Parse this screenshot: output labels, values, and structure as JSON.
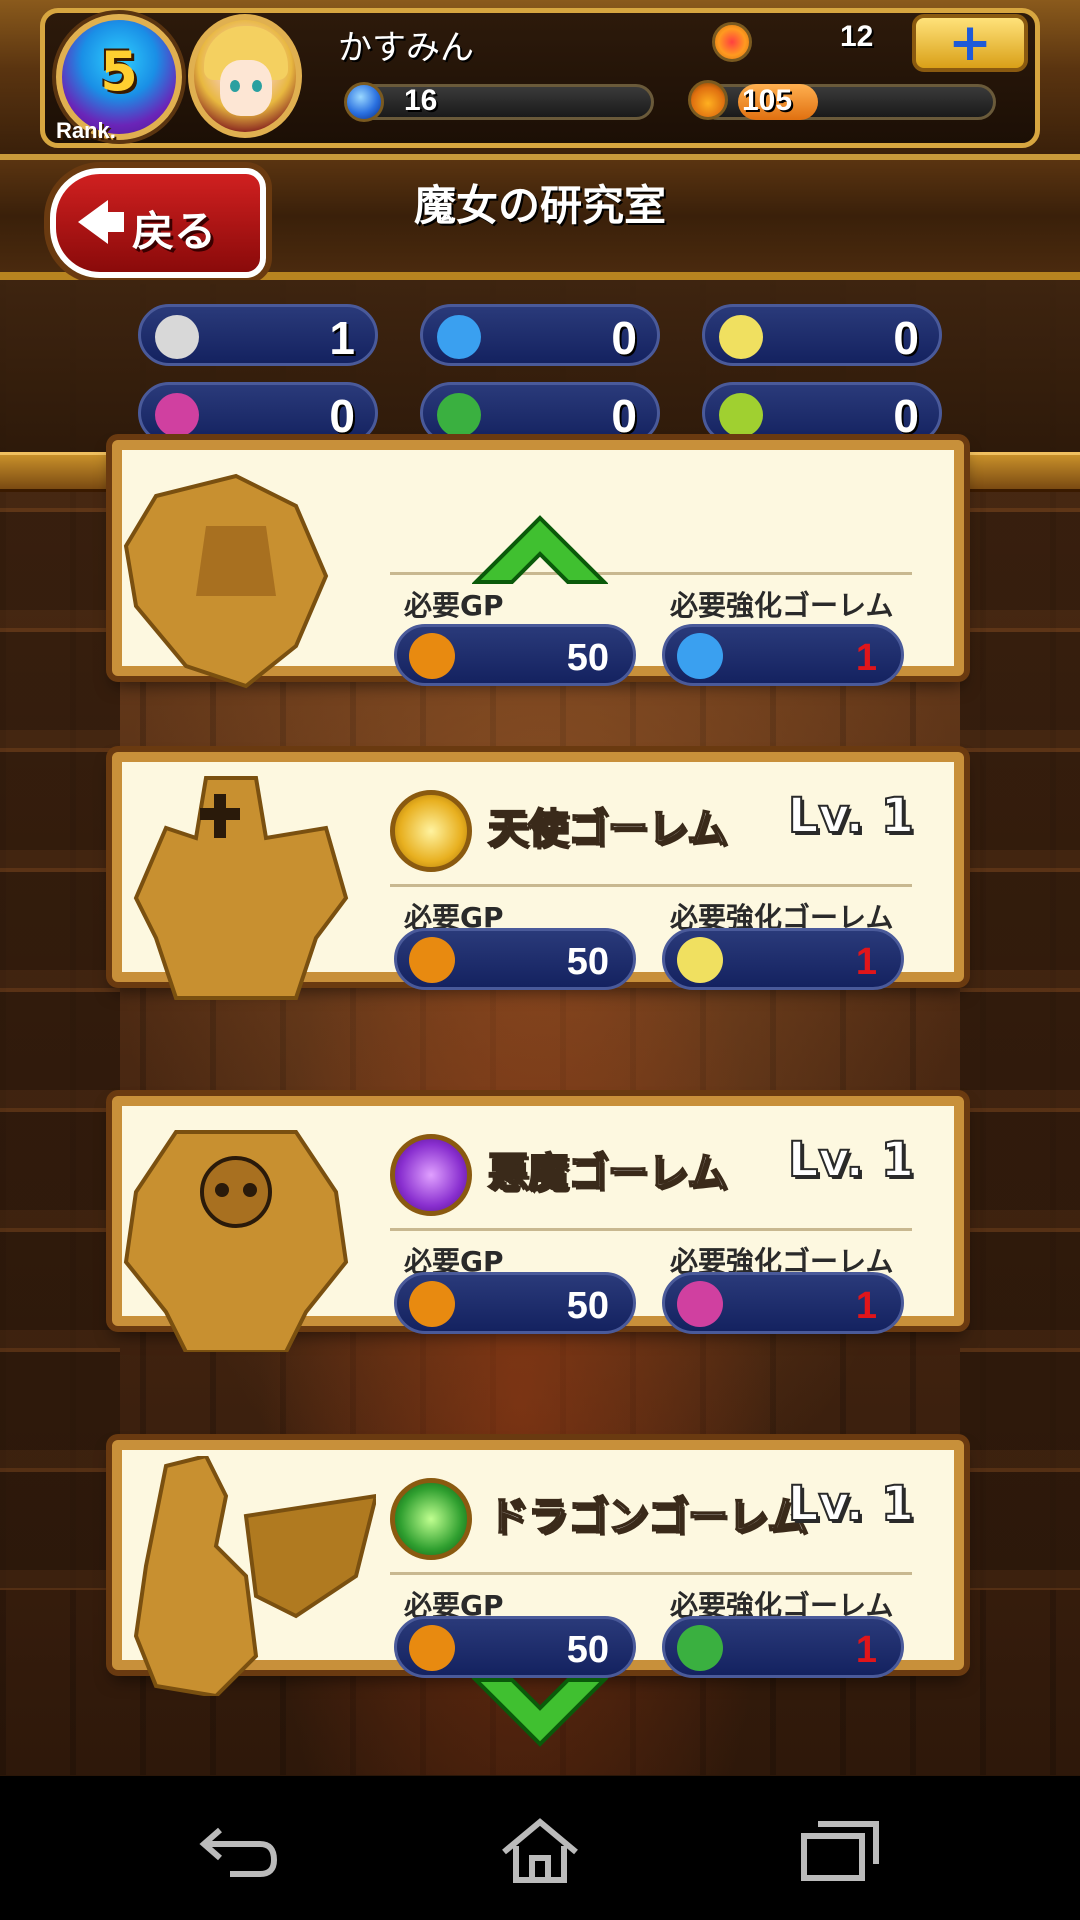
{
  "header": {
    "rank": "5",
    "rank_label": "Rank.",
    "player_name": "かすみん",
    "gem_count": "12",
    "plus_label": "+",
    "blue_orb_count": "16",
    "gp_count": "105"
  },
  "titlebar": {
    "back_label": "戻る",
    "title": "魔女の研究室"
  },
  "inventory": [
    {
      "icon": "white-golem-icon",
      "color": "#d8d8d8",
      "value": "1"
    },
    {
      "icon": "blue-golem-icon",
      "color": "#3aa0f0",
      "value": "0"
    },
    {
      "icon": "angel-golem-icon",
      "color": "#f0e060",
      "value": "0"
    },
    {
      "icon": "demon-golem-icon",
      "color": "#d040a0",
      "value": "0"
    },
    {
      "icon": "dragon-golem-icon",
      "color": "#3ab040",
      "value": "0"
    },
    {
      "icon": "green-golem-icon",
      "color": "#a0d030",
      "value": "0"
    }
  ],
  "cards": [
    {
      "name": "",
      "lv_label": "",
      "emblem_color": "#3a70d8",
      "gp_label": "必要GP",
      "gp_value": "50",
      "golem_label": "必要強化ゴーレム",
      "golem_value": "1",
      "golem_icon_color": "#3aa0f0"
    },
    {
      "name": "天使ゴーレム",
      "lv_label": "Lv. 1",
      "emblem_color": "#e8b020",
      "gp_label": "必要GP",
      "gp_value": "50",
      "golem_label": "必要強化ゴーレム",
      "golem_value": "1",
      "golem_icon_color": "#f0e060"
    },
    {
      "name": "悪魔ゴーレム",
      "lv_label": "Lv. 1",
      "emblem_color": "#8a30d0",
      "gp_label": "必要GP",
      "gp_value": "50",
      "golem_label": "必要強化ゴーレム",
      "golem_value": "1",
      "golem_icon_color": "#d040a0"
    },
    {
      "name": "ドラゴンゴーレム",
      "lv_label": "Lv. 1",
      "emblem_color": "#30a030",
      "gp_label": "必要GP",
      "gp_value": "50",
      "golem_label": "必要強化ゴーレム",
      "golem_value": "1",
      "golem_icon_color": "#3ab040"
    }
  ],
  "colors": {
    "accent_gold": "#d7a640",
    "pill_blue": "#142260",
    "required_red": "#e0151a",
    "scroll_green": "#40c030"
  }
}
